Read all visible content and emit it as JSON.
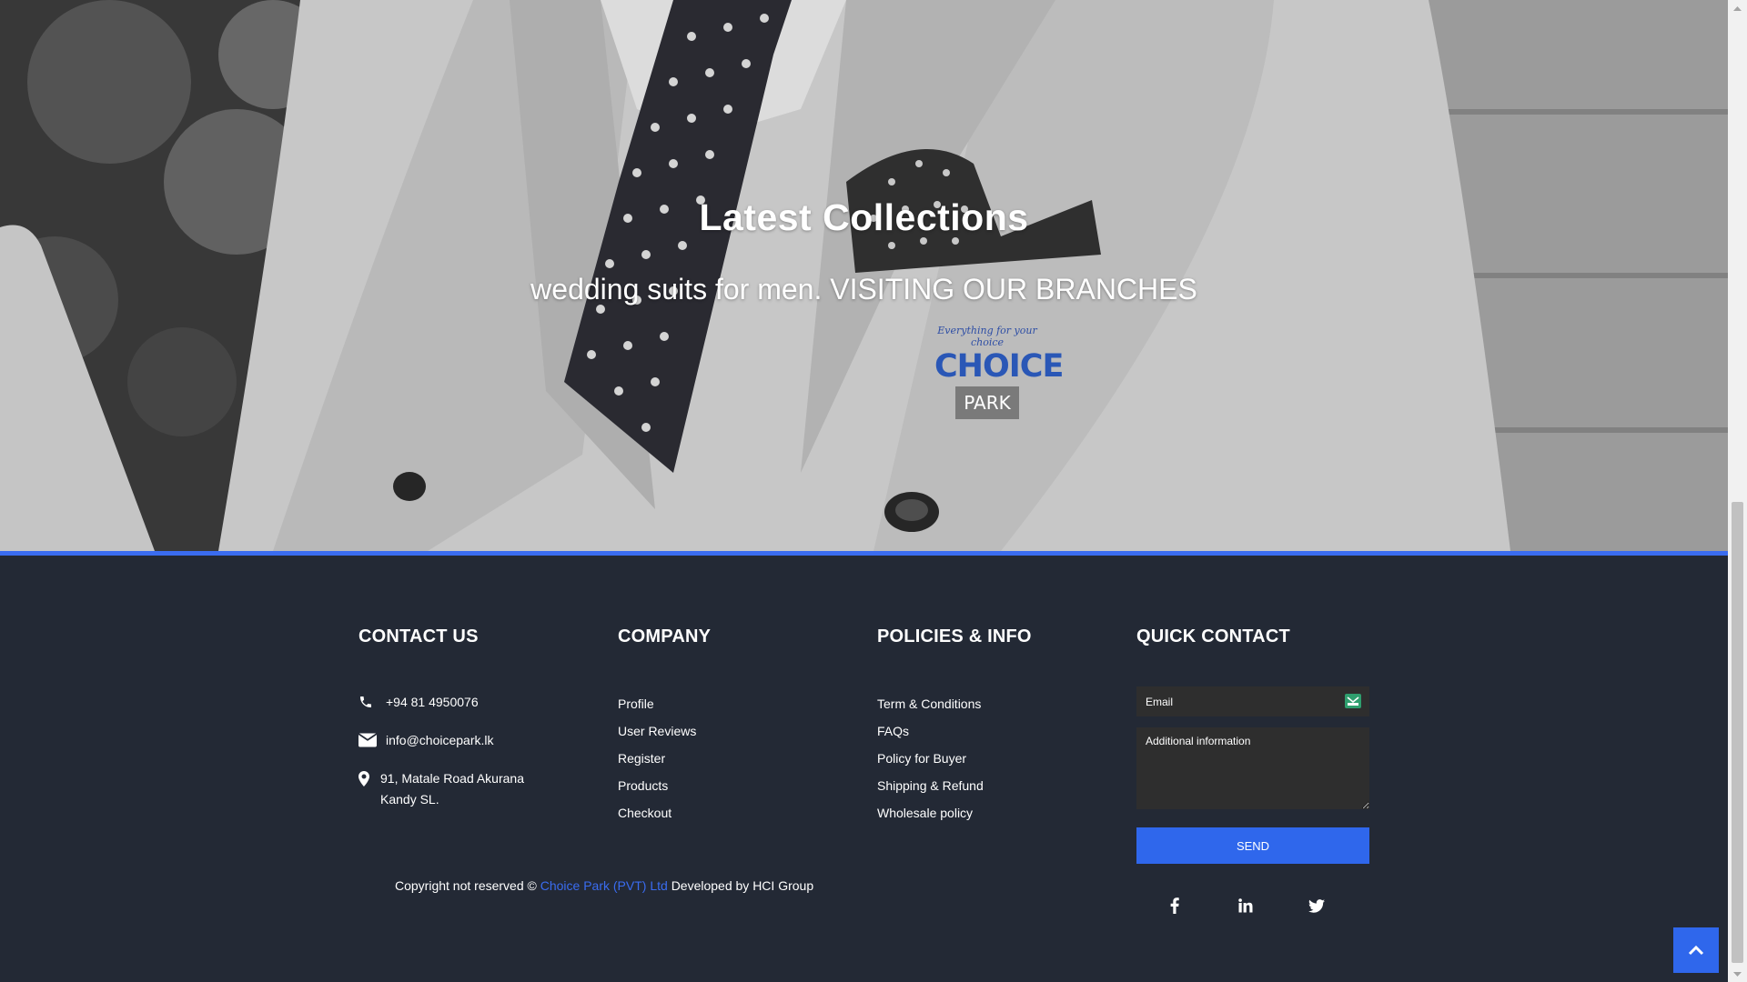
{
  "hero": {
    "title": "Latest Collections",
    "subtitle": "wedding suits for men. VISITING OUR BRANCHES",
    "logo": {
      "tagline": "Everything for your choice",
      "brand_top": "CHOICE",
      "brand_bottom": "PARK",
      "registered": "®"
    }
  },
  "footer": {
    "contact": {
      "heading": "CONTACT US",
      "phone": "+94 81 4950076",
      "email": "info@choicepark.lk",
      "address_line1": "91, Matale Road Akurana",
      "address_line2": "Kandy SL."
    },
    "company": {
      "heading": "COMPANY",
      "links": [
        "Profile",
        "User Reviews",
        "Register",
        "Products",
        "Checkout"
      ]
    },
    "policies": {
      "heading": "POLICIES & INFO",
      "links": [
        "Term & Conditions",
        "FAQs",
        "Policy for Buyer",
        "Shipping & Refund",
        "Wholesale policy"
      ]
    },
    "quick_contact": {
      "heading": "QUICK CONTACT",
      "email_placeholder": "Email",
      "info_placeholder": "Additional information",
      "send_label": "SEND",
      "social_icons": [
        "facebook-icon",
        "linkedin-icon",
        "twitter-icon"
      ]
    },
    "copyright": {
      "prefix": "Copyright not reserved ©",
      "brand": "Choice Park (PVT) Ltd",
      "suffix": "Developed by HCI Group"
    }
  },
  "colors": {
    "accent": "#2f67ec",
    "footer_bg": "#232935",
    "logo_blue": "#2a57b6"
  }
}
